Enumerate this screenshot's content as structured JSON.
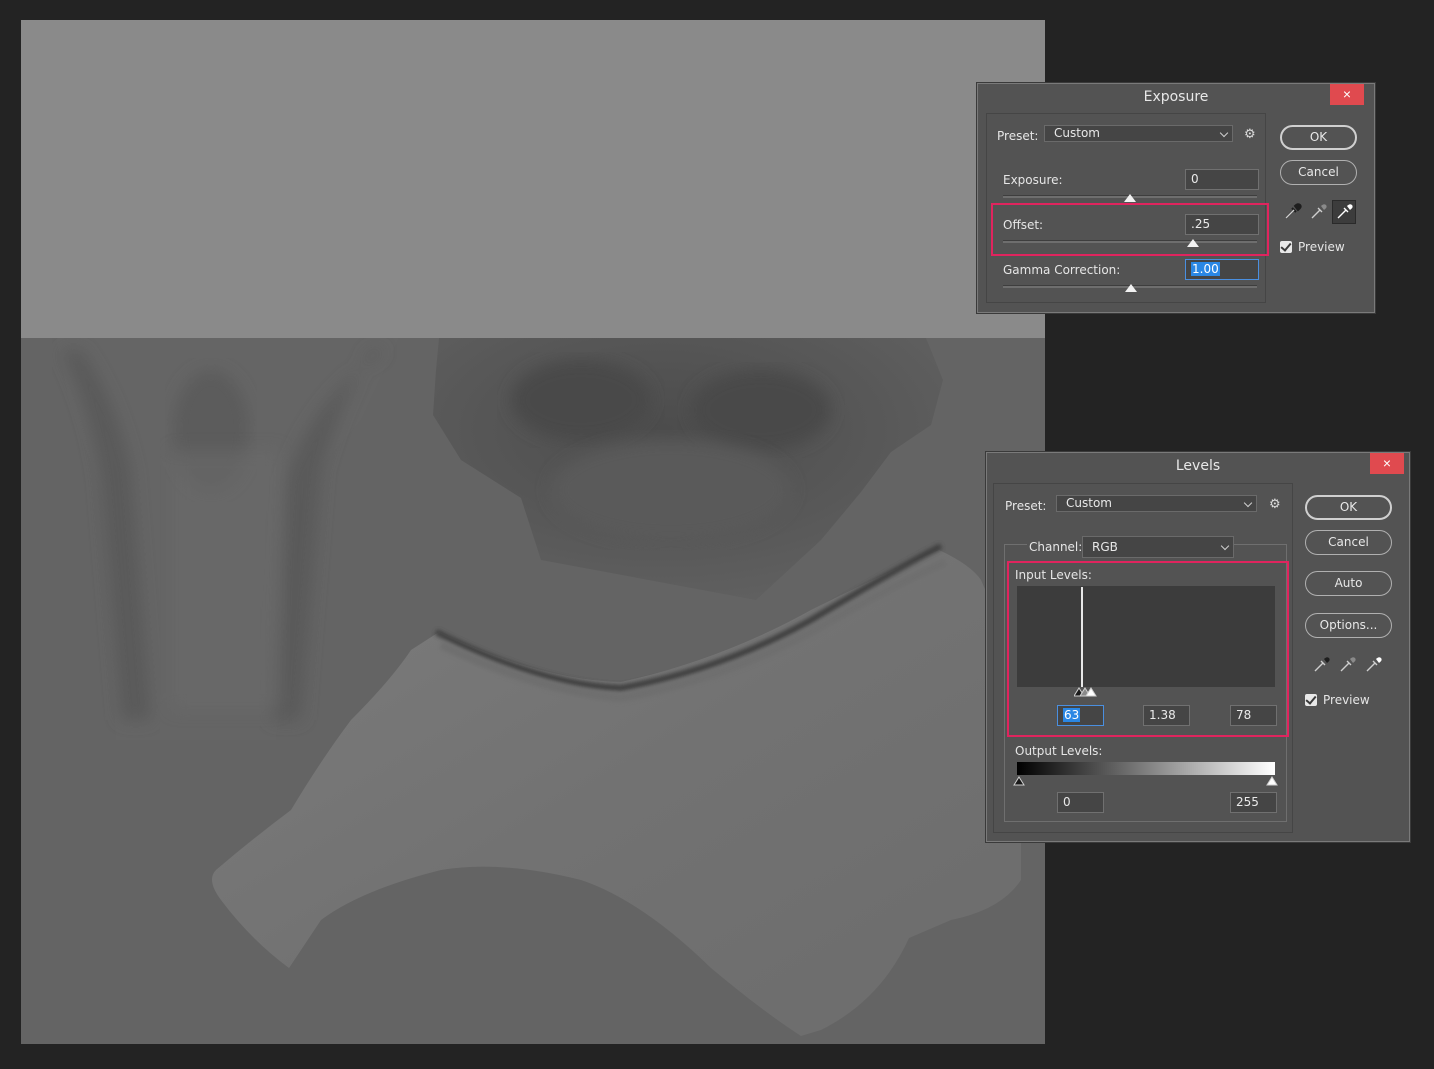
{
  "exposure_dialog": {
    "title": "Exposure",
    "close_icon": "×",
    "preset_label": "Preset:",
    "preset_value": "Custom",
    "settings_icon": "⚙",
    "exposure_label": "Exposure:",
    "exposure_value": "0",
    "offset_label": "Offset:",
    "offset_value": ".25",
    "gamma_label": "Gamma Correction:",
    "gamma_value": "1.00",
    "ok_label": "OK",
    "cancel_label": "Cancel",
    "preview_label": "Preview",
    "preview_checked": true
  },
  "levels_dialog": {
    "title": "Levels",
    "close_icon": "×",
    "preset_label": "Preset:",
    "preset_value": "Custom",
    "settings_icon": "⚙",
    "channel_label": "Channel:",
    "channel_value": "RGB",
    "input_levels_label": "Input Levels:",
    "input_black": "63",
    "input_gamma": "1.38",
    "input_white": "78",
    "output_levels_label": "Output Levels:",
    "output_black": "0",
    "output_white": "255",
    "ok_label": "OK",
    "cancel_label": "Cancel",
    "auto_label": "Auto",
    "options_label": "Options...",
    "preview_label": "Preview",
    "preview_checked": true
  },
  "colors": {
    "background": "#232323",
    "dialog": "#535353",
    "highlight": "#e0245e",
    "close_button": "#e04a4f",
    "selection": "#2a87e4"
  },
  "icons": [
    "close-icon",
    "gear-icon",
    "eyedropper-black-icon",
    "eyedropper-gray-icon",
    "eyedropper-white-icon",
    "checkbox-icon",
    "chevron-down-icon"
  ]
}
